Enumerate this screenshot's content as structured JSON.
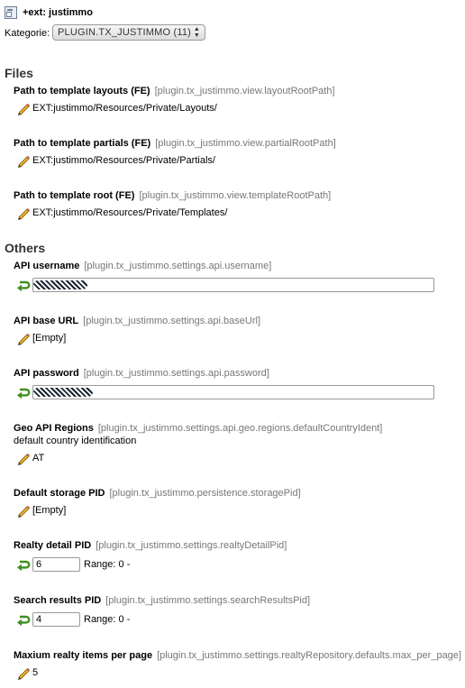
{
  "header": {
    "ext_title": "+ext: justimmo",
    "category_label": "Kategorie:",
    "category_selected": "PLUGIN.TX_JUSTIMMO (11)"
  },
  "sections": {
    "files": "Files",
    "others": "Others"
  },
  "options": {
    "layouts": {
      "title": "Path to template layouts (FE)",
      "key": "[plugin.tx_justimmo.view.layoutRootPath]",
      "value": "EXT:justimmo/Resources/Private/Layouts/"
    },
    "partials": {
      "title": "Path to template partials (FE)",
      "key": "[plugin.tx_justimmo.view.partialRootPath]",
      "value": "EXT:justimmo/Resources/Private/Partials/"
    },
    "templates": {
      "title": "Path to template root (FE)",
      "key": "[plugin.tx_justimmo.view.templateRootPath]",
      "value": "EXT:justimmo/Resources/Private/Templates/"
    },
    "username": {
      "title": "API username",
      "key": "[plugin.tx_justimmo.settings.api.username]"
    },
    "baseurl": {
      "title": "API base URL",
      "key": "[plugin.tx_justimmo.settings.api.baseUrl]",
      "value": "[Empty]"
    },
    "password": {
      "title": "API password",
      "key": "[plugin.tx_justimmo.settings.api.password]"
    },
    "regions": {
      "title": "Geo API Regions",
      "key": "[plugin.tx_justimmo.settings.api.geo.regions.defaultCountryIdent]",
      "description": "default country identification",
      "value": "AT"
    },
    "storage": {
      "title": "Default storage PID",
      "key": "[plugin.tx_justimmo.persistence.storagePid]",
      "value": "[Empty]"
    },
    "detail": {
      "title": "Realty detail PID",
      "key": "[plugin.tx_justimmo.settings.realtyDetailPid]",
      "value": "6",
      "range": "Range: 0 -"
    },
    "search": {
      "title": "Search results PID",
      "key": "[plugin.tx_justimmo.settings.searchResultsPid]",
      "value": "4",
      "range": "Range: 0 -"
    },
    "maxitems": {
      "title": "Maxium realty items per page",
      "key": "[plugin.tx_justimmo.settings.realtyRepository.defaults.max_per_page]",
      "value": "5"
    }
  },
  "icons": {
    "ext": "extension-icon",
    "edit": "pencil-icon",
    "reset": "undo-arrow-icon"
  },
  "colors": {
    "key_text": "#777777",
    "section_text": "#333333",
    "reset_icon": "#3f8f1f",
    "pencil": "#e0a020"
  }
}
